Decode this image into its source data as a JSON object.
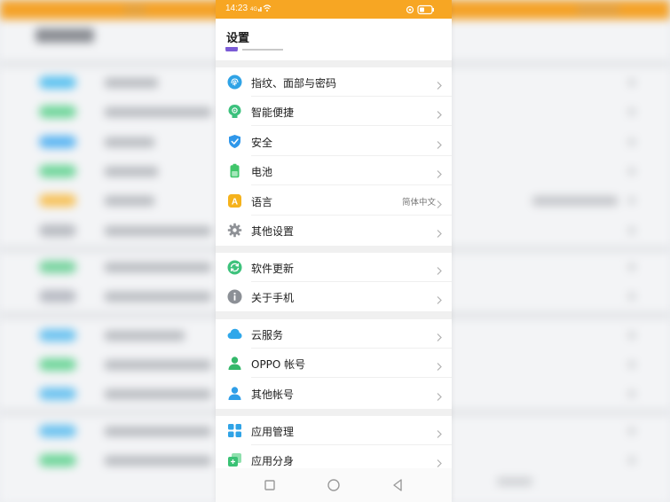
{
  "status_bar": {
    "time": "14:23",
    "signal_text": "4G"
  },
  "header": {
    "title": "设置"
  },
  "groups": [
    {
      "items": [
        {
          "label": "指纹、面部与密码",
          "icon": "fingerprint-icon",
          "color": "#2fa3e6"
        },
        {
          "label": "智能便捷",
          "icon": "smart-assist-icon",
          "color": "#3cc17d"
        },
        {
          "label": "安全",
          "icon": "shield-icon",
          "color": "#2f97ea"
        },
        {
          "label": "电池",
          "icon": "battery-icon",
          "color": "#41c66b"
        },
        {
          "label": "语言",
          "icon": "language-icon",
          "color": "#f5b21c",
          "value": "简体中文",
          "badge": "A"
        },
        {
          "label": "其他设置",
          "icon": "gear-icon",
          "color": "#8e9196"
        }
      ]
    },
    {
      "items": [
        {
          "label": "软件更新",
          "icon": "update-icon",
          "color": "#3ec27c"
        },
        {
          "label": "关于手机",
          "icon": "info-icon",
          "color": "#8c9096"
        }
      ]
    },
    {
      "items": [
        {
          "label": "云服务",
          "icon": "cloud-icon",
          "color": "#2fa7ea"
        },
        {
          "label": "OPPO 帐号",
          "icon": "account-icon",
          "color": "#34b86a"
        },
        {
          "label": "其他帐号",
          "icon": "user-icon",
          "color": "#2f9ee8"
        }
      ]
    },
    {
      "items": [
        {
          "label": "应用管理",
          "icon": "apps-grid-icon",
          "color": "#2fa3e6"
        },
        {
          "label": "应用分身",
          "icon": "app-clone-icon",
          "color": "#3ac275"
        }
      ]
    }
  ],
  "colors": {
    "accent": "#f7a623",
    "divider": "#f0f0f0"
  }
}
